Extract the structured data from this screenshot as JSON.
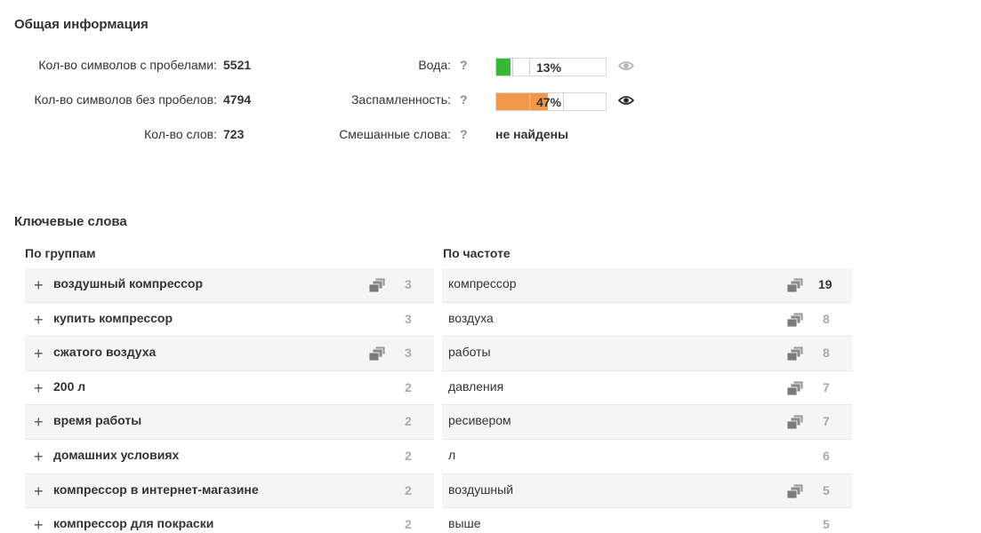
{
  "general": {
    "title": "Общая информация",
    "chars_with_spaces_label": "Кол-во символов с пробелами:",
    "chars_with_spaces_value": "5521",
    "chars_without_spaces_label": "Кол-во символов без пробелов:",
    "chars_without_spaces_value": "4794",
    "words_label": "Кол-во слов:",
    "words_value": "723",
    "water_label": "Вода:",
    "water_percent_text": "13%",
    "water_fraction": 0.13,
    "spam_label": "Заспамленность:",
    "spam_percent_text": "47%",
    "spam_fraction": 0.47,
    "mixed_label": "Смешанные слова:",
    "mixed_value": "не найдены",
    "help_glyph": "?",
    "colors": {
      "water_fill": "#33bb33",
      "spam_fill": "#f0994a"
    }
  },
  "keywords": {
    "title": "Ключевые слова",
    "by_groups_title": "По группам",
    "by_frequency_title": "По частоте",
    "groups": [
      {
        "label": "воздушный компрессор",
        "count": "3",
        "has_copy": true
      },
      {
        "label": "купить компрессор",
        "count": "3",
        "has_copy": false
      },
      {
        "label": "сжатого воздуха",
        "count": "3",
        "has_copy": true
      },
      {
        "label": "200 л",
        "count": "2",
        "has_copy": false
      },
      {
        "label": "время работы",
        "count": "2",
        "has_copy": false
      },
      {
        "label": "домашних условиях",
        "count": "2",
        "has_copy": false
      },
      {
        "label": "компрессор в интернет-магазине",
        "count": "2",
        "has_copy": false
      },
      {
        "label": "компрессор для покраски",
        "count": "2",
        "has_copy": false
      }
    ],
    "frequency": [
      {
        "label": "компрессор",
        "count": "19",
        "has_copy": true
      },
      {
        "label": "воздуха",
        "count": "8",
        "has_copy": true
      },
      {
        "label": "работы",
        "count": "8",
        "has_copy": true
      },
      {
        "label": "давления",
        "count": "7",
        "has_copy": true
      },
      {
        "label": "ресивером",
        "count": "7",
        "has_copy": true
      },
      {
        "label": "л",
        "count": "6",
        "has_copy": false
      },
      {
        "label": "воздушный",
        "count": "5",
        "has_copy": true
      },
      {
        "label": "выше",
        "count": "5",
        "has_copy": false
      }
    ]
  }
}
